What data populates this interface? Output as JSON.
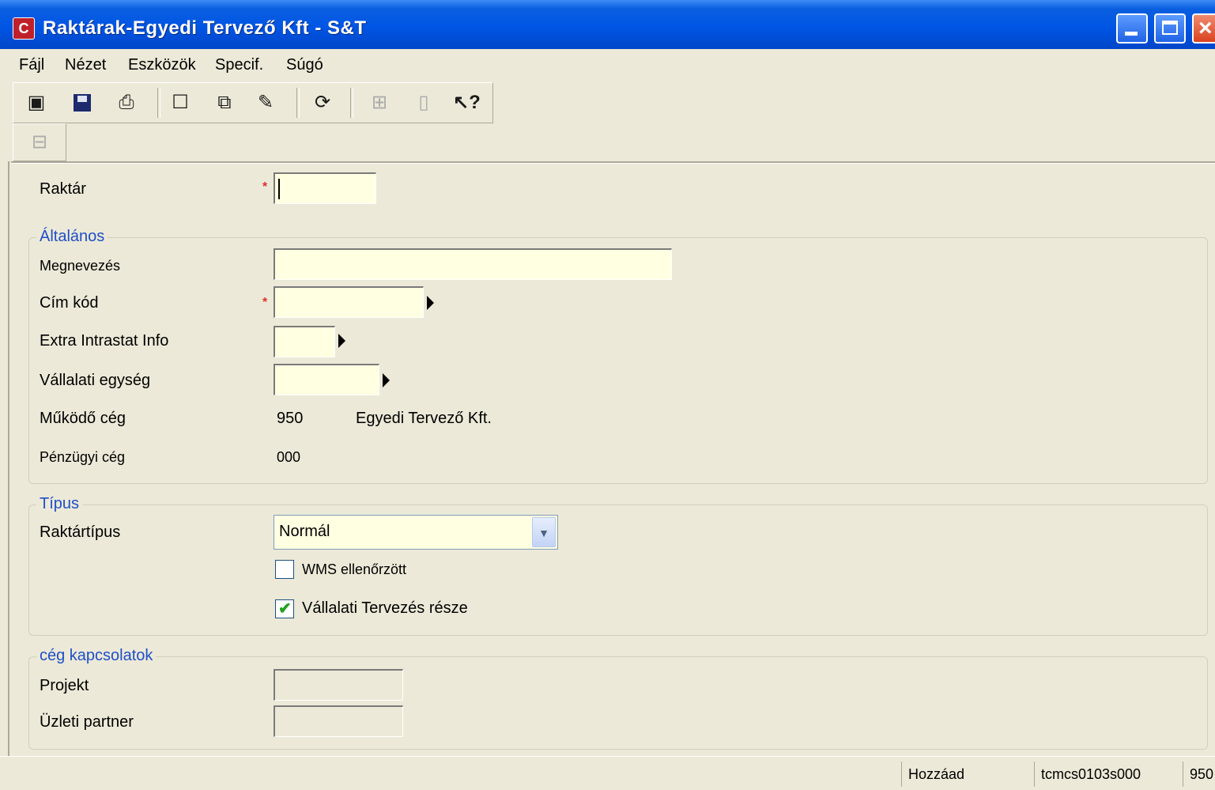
{
  "window": {
    "title": "Raktárak-Egyedi Tervező Kft - S&T",
    "icon_letter": "C"
  },
  "menu": [
    {
      "label": "Fájl"
    },
    {
      "label": "Nézet"
    },
    {
      "label": "Eszközök"
    },
    {
      "label": "Specif."
    },
    {
      "label": "Súgó"
    }
  ],
  "toolbar": {
    "icons": [
      "open-icon",
      "save-icon",
      "print-icon",
      "new-icon",
      "copy-icon",
      "edit-icon",
      "refresh-icon",
      "disabled-icon-1",
      "disabled-icon-2",
      "help-icon"
    ]
  },
  "form": {
    "raktar_label": "Raktár",
    "raktar_value": "",
    "general": {
      "title": "Általános",
      "megnevezes_label": "Megnevezés",
      "megnevezes_value": "",
      "cimkod_label": "Cím kód",
      "cimkod_value": "",
      "intrastat_label": "Extra Intrastat Info",
      "intrastat_value": "",
      "vallalati_label": "Vállalati egység",
      "vallalati_value": "",
      "mukodo_ceg_label": "Működő cég",
      "mukodo_ceg_code": "950",
      "mukodo_ceg_name": "Egyedi Tervező Kft.",
      "penzugyi_ceg_label": "Pénzügyi cég",
      "penzugyi_ceg_code": "000"
    },
    "type": {
      "title": "Típus",
      "raktartipus_label": "Raktártípus",
      "raktartipus_value": "Normál",
      "wms_label": "WMS ellenőrzött",
      "wms_checked": false,
      "tervezes_label": "Vállalati Tervezés része",
      "tervezes_checked": true
    },
    "relations": {
      "title": "cég kapcsolatok",
      "projekt_label": "Projekt",
      "projekt_value": "",
      "partner_label": "Üzleti partner",
      "partner_value": ""
    }
  },
  "status": {
    "mode": "Hozzáad",
    "session": "tcmcs0103s000",
    "company": "950"
  }
}
